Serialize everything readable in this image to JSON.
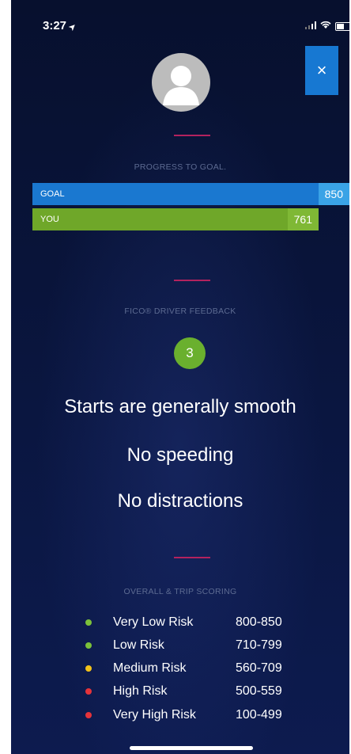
{
  "status_bar": {
    "time": "3:27",
    "time_arrow": "➤"
  },
  "close_button": {
    "glyph": "×"
  },
  "progress": {
    "title": "PROGRESS TO GOAL.",
    "goal_label": "GOAL",
    "goal_value": "850",
    "you_label": "YOU",
    "you_value": "761"
  },
  "feedback": {
    "title": "FICO® DRIVER FEEDBACK",
    "count": "3",
    "items": [
      "Starts are generally smooth",
      "No speeding",
      "No distractions"
    ]
  },
  "scoring": {
    "title": "OVERALL & TRIP SCORING",
    "rows": [
      {
        "label": "Very Low Risk",
        "range": "800-850",
        "color": "#7cc13a"
      },
      {
        "label": "Low Risk",
        "range": "710-799",
        "color": "#7cc13a"
      },
      {
        "label": "Medium Risk",
        "range": "560-709",
        "color": "#f2c21a"
      },
      {
        "label": "High Risk",
        "range": "500-559",
        "color": "#e5333a"
      },
      {
        "label": "Very High Risk",
        "range": "100-499",
        "color": "#e5333a"
      }
    ]
  },
  "colors": {
    "goal_bar": "#1a78d0",
    "you_bar": "#6fa729",
    "divider": "#b3225e",
    "badge": "#6ab02e"
  }
}
